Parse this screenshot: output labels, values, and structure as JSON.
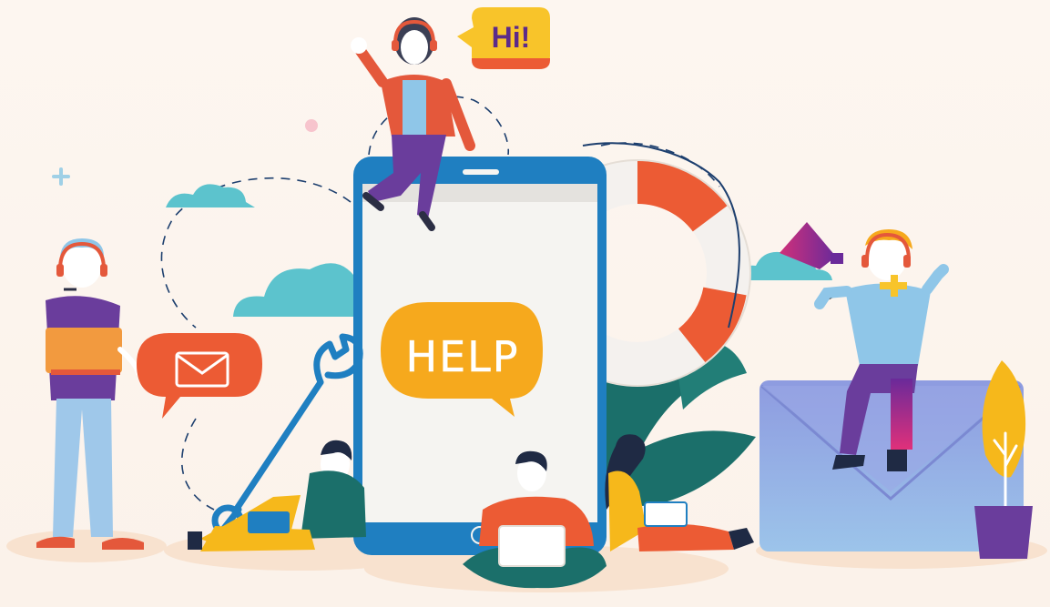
{
  "illustration": {
    "speech_bubble_text": "Hi!",
    "help_bubble_text": "HELP"
  },
  "colors": {
    "background": "#fcf4ee",
    "phone_frame": "#1f7fc1",
    "phone_screen": "#f5f4f1",
    "help_bubble": "#f6a91d",
    "hi_bubble": "#f8c42a",
    "hi_text": "#5c2a8a",
    "lifebuoy_red": "#ec5b34",
    "mail_bubble": "#ec5b34",
    "cloud": "#5cc3cd",
    "envelope": "#8fa3e0",
    "plant_leaf": "#f6b81b",
    "pot": "#6a3d9c",
    "foliage": "#1b6f6a"
  },
  "icons": [
    "envelope-icon",
    "wrench-icon",
    "plus-icon",
    "headset-icon",
    "laptop-icon",
    "megaphone-icon"
  ]
}
